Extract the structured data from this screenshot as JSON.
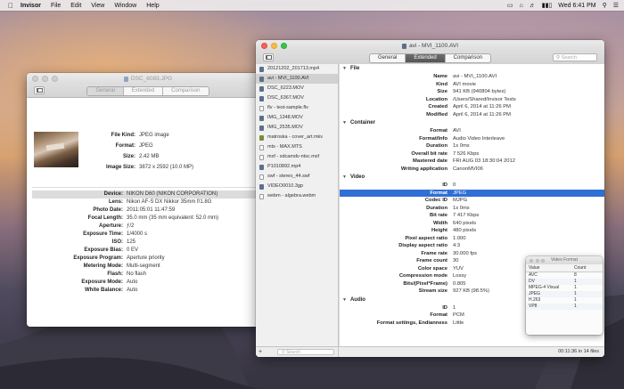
{
  "menubar": {
    "app_name": "Invisor",
    "items": [
      "File",
      "Edit",
      "View",
      "Window",
      "Help"
    ],
    "clock": "Wed 6:41 PM"
  },
  "jpg_window": {
    "title": "DSC_6083.JPG",
    "tabs": [
      "General",
      "Extended",
      "Comparison"
    ],
    "active_tab": "General",
    "summary": [
      {
        "key": "File Kind:",
        "value": "JPEG image"
      },
      {
        "key": "Format:",
        "value": "JPEG"
      },
      {
        "key": "Size:",
        "value": "2.42 MB"
      },
      {
        "key": "Image Size:",
        "value": "3872 x 2592 (10.0 MP)"
      }
    ],
    "exif": [
      {
        "key": "Device:",
        "value": "NIKON D60 (NIKON CORPORATION)"
      },
      {
        "key": "Lens:",
        "value": "Nikon AF-S DX Nikkor 35mm f/1.8G"
      },
      {
        "key": "Photo Date:",
        "value": "2011:05:01 11:47:59"
      },
      {
        "key": "Focal Length:",
        "value": "35.0 mm (35 mm equivalent: 52.0 mm)"
      },
      {
        "key": "Aperture:",
        "value": "ƒ/2"
      },
      {
        "key": "Exposure Time:",
        "value": "1/4000 s"
      },
      {
        "key": "ISO:",
        "value": "125"
      },
      {
        "key": "Exposure Bias:",
        "value": "0 EV"
      },
      {
        "key": "Exposure Program:",
        "value": "Aperture priority"
      },
      {
        "key": "Metering Mode:",
        "value": "Multi-segment"
      },
      {
        "key": "Flash:",
        "value": "No flash"
      },
      {
        "key": "Exposure Mode:",
        "value": "Auto"
      },
      {
        "key": "White Balance:",
        "value": "Auto"
      }
    ]
  },
  "avi_window": {
    "title": "avi - MVI_1100.AVI",
    "tabs": [
      "General",
      "Extended",
      "Comparison"
    ],
    "active_tab": "Extended",
    "search_placeholder": "Search",
    "files": [
      "20121202_201713.mp4",
      "avi - MVI_1100.AVI",
      "DSC_6223.MOV",
      "DSC_6367.MOV",
      "flv - test-sample.flv",
      "IMG_1348.MOV",
      "IMG_2535.MOV",
      "matroska - cover_art.mkv",
      "mts - MAX.MTS",
      "mxf - xdcamdv-ntsc.mxf",
      "P1010892.mp4",
      "swf - stereo_44.swf",
      "VIDEO0010.3gp",
      "webm - algebra.webm"
    ],
    "filter_placeholder": "Search",
    "status": "00:11:36 in 14 files",
    "sections": [
      {
        "name": "File",
        "rows": [
          {
            "key": "Name",
            "value": "avi - MVI_1100.AVI"
          },
          {
            "key": "Kind",
            "value": "AVI movie"
          },
          {
            "key": "Size",
            "value": "941 KB (940804 bytes)"
          },
          {
            "key": "Location",
            "value": "/Users/Shared/Invisor Tests"
          },
          {
            "key": "Created",
            "value": "April 6, 2014 at 11:26 PM"
          },
          {
            "key": "Modified",
            "value": "April 6, 2014 at 11:26 PM"
          }
        ]
      },
      {
        "name": "Container",
        "rows": [
          {
            "key": "Format",
            "value": "AVI"
          },
          {
            "key": "Format/Info",
            "value": "Audio Video Interleave"
          },
          {
            "key": "Duration",
            "value": "1s 0ms"
          },
          {
            "key": "Overall bit rate",
            "value": "7 526 Kbps"
          },
          {
            "key": "Mastered date",
            "value": "FRI AUG 03 18:30:04 2012"
          },
          {
            "key": "Writing application",
            "value": "CanonMVI06"
          }
        ]
      },
      {
        "name": "Video",
        "rows": [
          {
            "key": "ID",
            "value": "0"
          },
          {
            "key": "Format",
            "value": "JPEG",
            "selected": true
          },
          {
            "key": "Codec ID",
            "value": "MJPG"
          },
          {
            "key": "Duration",
            "value": "1s 0ms"
          },
          {
            "key": "Bit rate",
            "value": "7 417 Kbps"
          },
          {
            "key": "Width",
            "value": "640 pixels"
          },
          {
            "key": "Height",
            "value": "480 pixels"
          },
          {
            "key": "Pixel aspect ratio",
            "value": "1.000"
          },
          {
            "key": "Display aspect ratio",
            "value": "4:3"
          },
          {
            "key": "Frame rate",
            "value": "30.000 fps"
          },
          {
            "key": "Frame count",
            "value": "30"
          },
          {
            "key": "Color space",
            "value": "YUV"
          },
          {
            "key": "Compression mode",
            "value": "Lossy"
          },
          {
            "key": "Bits/(Pixel*Frame)",
            "value": "0.805"
          },
          {
            "key": "Stream size",
            "value": "927 KB (98.5%)"
          }
        ]
      },
      {
        "name": "Audio",
        "rows": [
          {
            "key": "ID",
            "value": "1"
          },
          {
            "key": "Format",
            "value": "PCM"
          },
          {
            "key": "Format settings, Endianness",
            "value": "Little"
          }
        ]
      }
    ]
  },
  "video_format_panel": {
    "title": "Video Format",
    "headers": [
      "Value",
      "Count"
    ],
    "rows": [
      {
        "value": "AVC",
        "count": "8"
      },
      {
        "value": "DV",
        "count": "1"
      },
      {
        "value": "MPEG-4 Visual",
        "count": "1"
      },
      {
        "value": "JPEG",
        "count": "1"
      },
      {
        "value": "H.263",
        "count": "1"
      },
      {
        "value": "VP8",
        "count": "1"
      }
    ]
  }
}
